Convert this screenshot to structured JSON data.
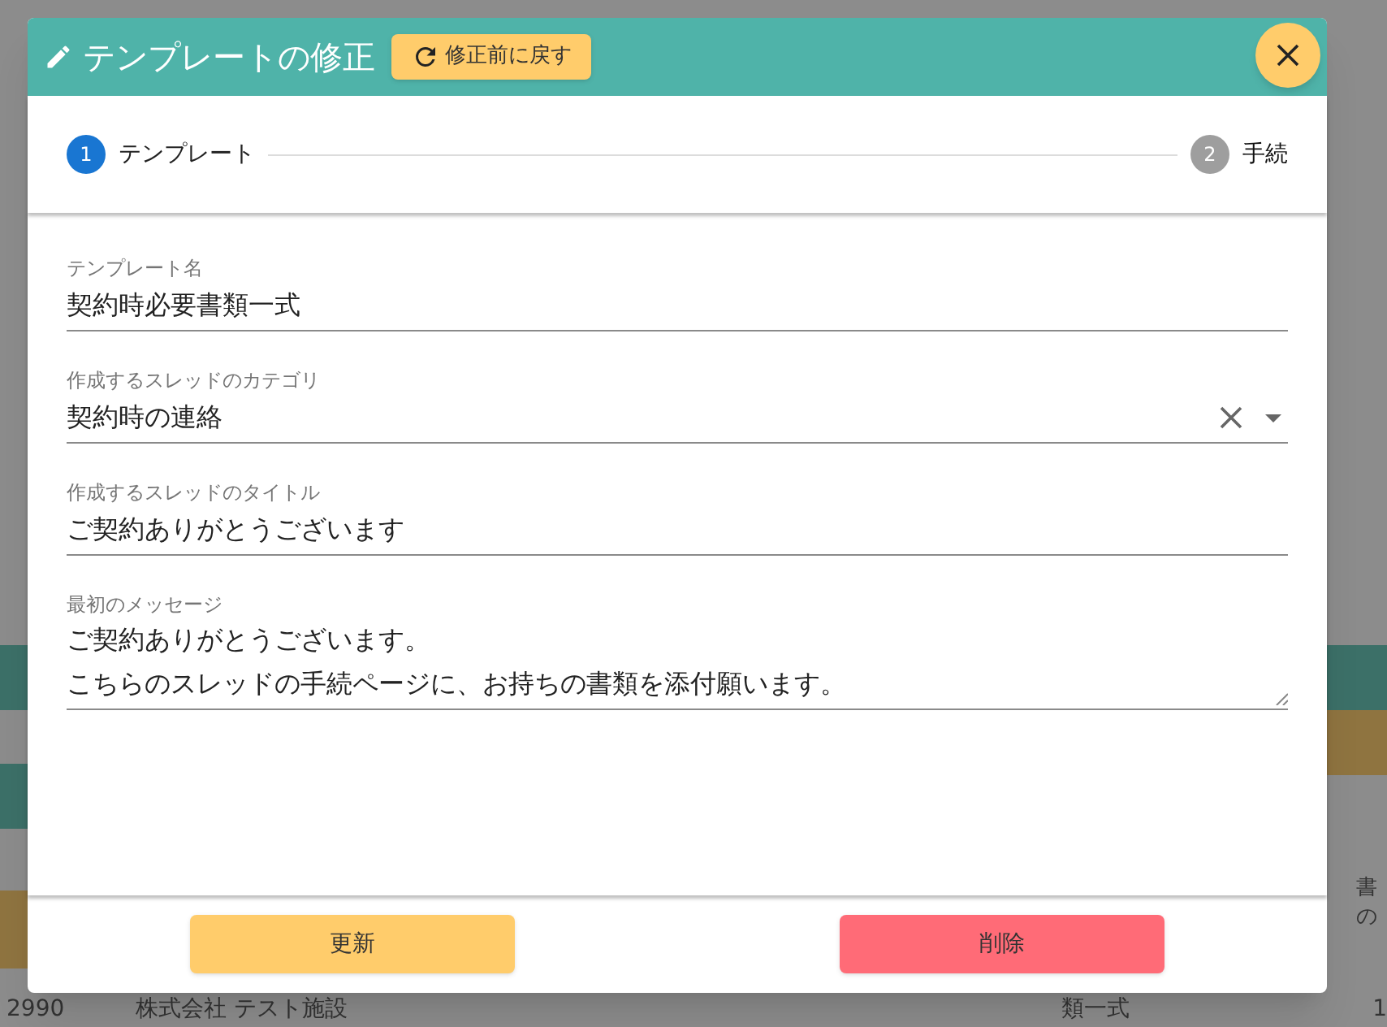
{
  "background": {
    "right_header": [
      "書",
      "の"
    ],
    "bottom_row": [
      "2990",
      "株式会社 テスト施設",
      "類一式",
      "1"
    ]
  },
  "dialog": {
    "title": "テンプレートの修正",
    "revert_button": "修正前に戻す",
    "steps": [
      {
        "number": "1",
        "label": "テンプレート",
        "selected": true
      },
      {
        "number": "2",
        "label": "手続",
        "selected": false
      }
    ],
    "fields": [
      {
        "kind": "text",
        "label": "テンプレート名",
        "value": "契約時必要書類一式"
      },
      {
        "kind": "select",
        "label": "作成するスレッドのカテゴリ",
        "value": "契約時の連絡"
      },
      {
        "kind": "text",
        "label": "作成するスレッドのタイトル",
        "value": "ご契約ありがとうございます"
      },
      {
        "kind": "textarea",
        "label": "最初のメッセージ",
        "lines": [
          "ご契約ありがとうございます。",
          "こちらのスレッドの手続ページに、お持ちの書類を添付願います。"
        ]
      }
    ],
    "buttons": [
      {
        "kind": "update",
        "label": "更新"
      },
      {
        "kind": "delete",
        "label": "削除"
      }
    ]
  }
}
